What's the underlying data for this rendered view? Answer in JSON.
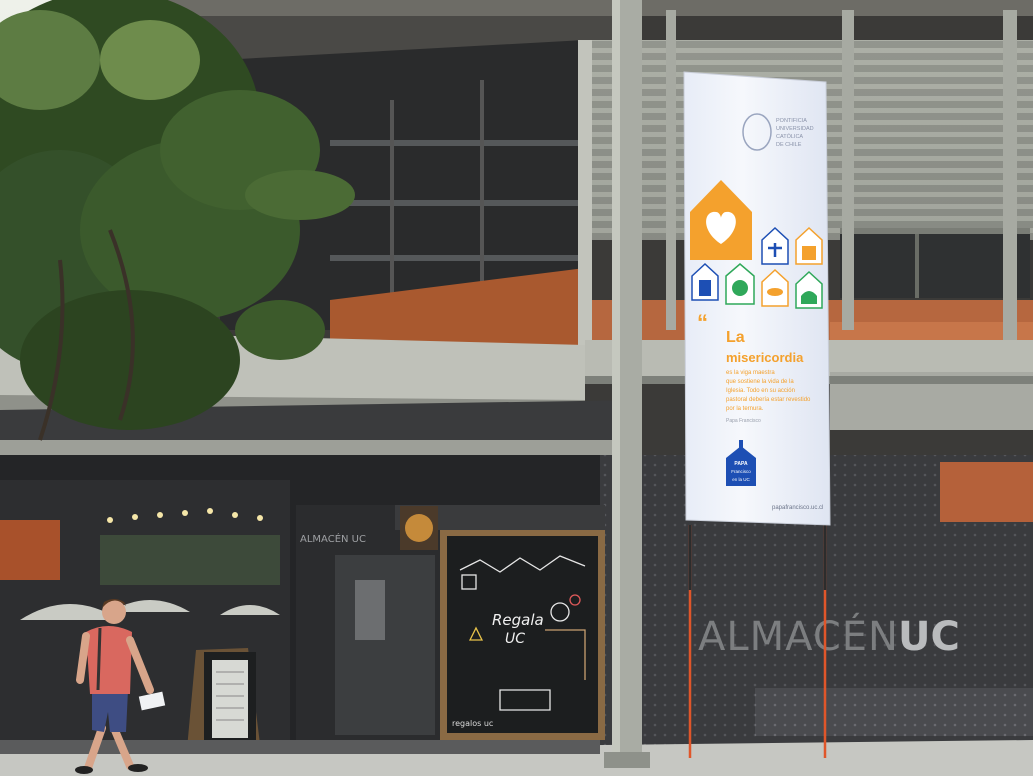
{
  "scene": {
    "colors": {
      "concrete": "#b7b9b1",
      "wood": "#b8653d",
      "glass_dark": "#2a2c2f",
      "facade_dark": "#2f3033",
      "tree": "#2f4a22",
      "sky": "#e9ece6",
      "banner_bg": "#f4f6fb",
      "banner_orange": "#f4a12d",
      "banner_blue": "#1d4fb4",
      "banner_green": "#2fa85a",
      "pole": "#a9aca4",
      "cable": "#e0562a",
      "shirt": "#d9685f",
      "shorts": "#3e4d83"
    }
  },
  "banner": {
    "crest_text_lines": [
      "PONTIFICIA",
      "UNIVERSIDAD",
      "CATÓLICA",
      "DE CHILE"
    ],
    "quote_mark": "“",
    "headline_line1": "La",
    "headline_line2": "misericordia",
    "body_lines": [
      "es la viga maestra",
      "que sostiene la vida de la",
      "Iglesia. Todo en su acción",
      "pastoral debería estar revestido",
      "por la ternura."
    ],
    "attribution": "Papa Francisco",
    "badge_line1": "PAPA",
    "badge_line2": "Francisco",
    "badge_line3": "en la UC",
    "url": "papafrancisco.uc.cl"
  },
  "storefront": {
    "name_left": "ALMACÉN",
    "name_right": "UC",
    "small_sign": "ALMACÉN UC"
  },
  "chalkboard": {
    "line1": "Regala",
    "line2": "UC",
    "footer": "regalos uc"
  }
}
